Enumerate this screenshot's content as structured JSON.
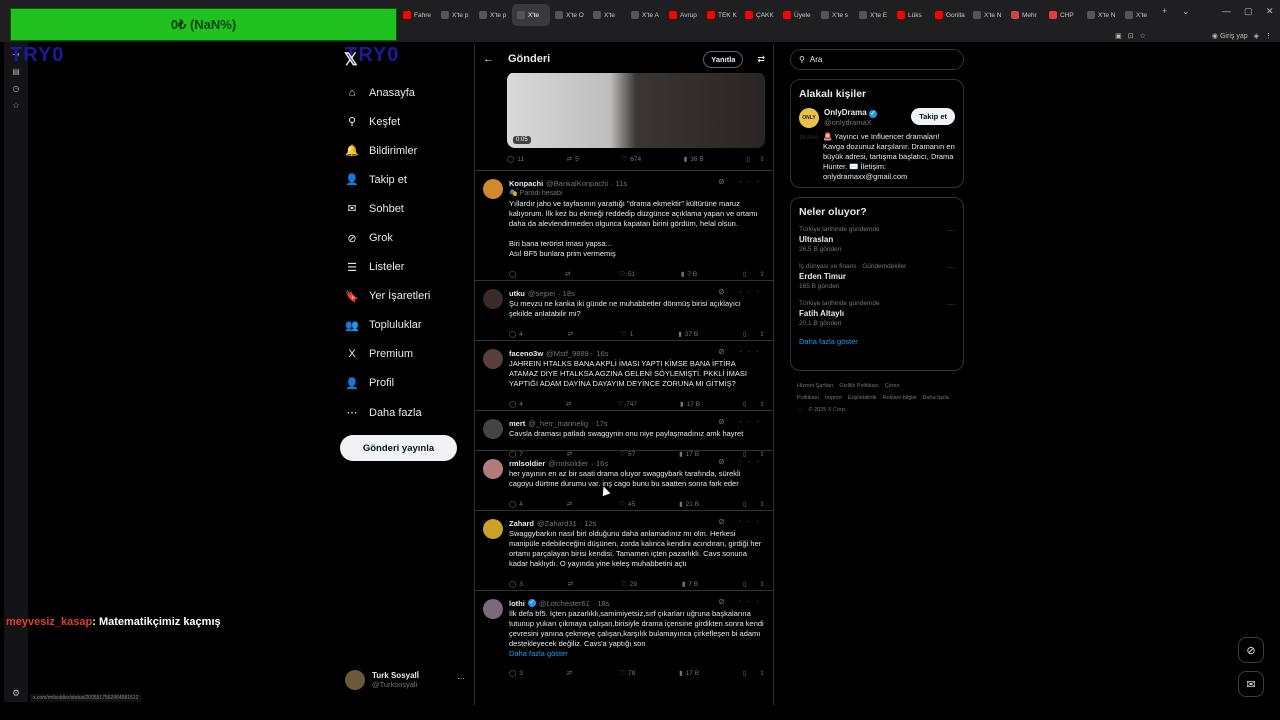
{
  "browser": {
    "tabs": [
      {
        "label": "Fahre",
        "color": "#ff0000"
      },
      {
        "label": "X'te p",
        "color": "#555"
      },
      {
        "label": "X'te p",
        "color": "#555"
      },
      {
        "label": "X'te",
        "color": "#555",
        "active": true
      },
      {
        "label": "X'te O",
        "color": "#555"
      },
      {
        "label": "X'te",
        "color": "#555"
      },
      {
        "label": "X'te A",
        "color": "#555"
      },
      {
        "label": "Avrup",
        "color": "#ff0000"
      },
      {
        "label": "TEK K",
        "color": "#ff0000"
      },
      {
        "label": "ÇAKK",
        "color": "#ff0000"
      },
      {
        "label": "Üyele",
        "color": "#ff0000"
      },
      {
        "label": "X'te s",
        "color": "#555"
      },
      {
        "label": "X'te E",
        "color": "#555"
      },
      {
        "label": "Lüks",
        "color": "#ff0000"
      },
      {
        "label": "Gorilla",
        "color": "#ff0000"
      },
      {
        "label": "X'te N",
        "color": "#555"
      },
      {
        "label": "Mehr",
        "color": "#c44"
      },
      {
        "label": "CHP",
        "color": "#e23b3b"
      },
      {
        "label": "X'te N",
        "color": "#555"
      },
      {
        "label": "X'te",
        "color": "#555"
      }
    ],
    "signin_label": "Giriş yap",
    "status_url": "x.com/rmlsoldier/status/2005517562964581512"
  },
  "overlay": {
    "counter": "0₺ (NaN%)",
    "watermark_left": "TRY0",
    "watermark_mid": "TRY0",
    "chat_user": "meyvesiz_kasap",
    "chat_msg": ": Matematikçimiz kaçmış"
  },
  "nav": {
    "items": [
      {
        "label": "Anasayfa",
        "icon": "⌂"
      },
      {
        "label": "Keşfet",
        "icon": "⚲"
      },
      {
        "label": "Bildirimler",
        "icon": "🔔"
      },
      {
        "label": "Takip et",
        "icon": "👤"
      },
      {
        "label": "Sohbet",
        "icon": "✉"
      },
      {
        "label": "Grok",
        "icon": "⊘"
      },
      {
        "label": "Listeler",
        "icon": "☰"
      },
      {
        "label": "Yer İşaretleri",
        "icon": "🔖"
      },
      {
        "label": "Topluluklar",
        "icon": "👥"
      },
      {
        "label": "Premium",
        "icon": "X"
      },
      {
        "label": "Profil",
        "icon": "👤"
      },
      {
        "label": "Daha fazla",
        "icon": "⋯"
      }
    ],
    "post_button": "Gönderi yayınla",
    "account_name": "Turk Sosyalİ",
    "account_handle": "@Turksosyali"
  },
  "main": {
    "title": "Gönderi",
    "reply_button": "Yanıtla",
    "media_duration": "0:05",
    "media_stats": {
      "replies": "11",
      "reposts": "5",
      "likes": "674",
      "views": "36 B"
    },
    "posts": [
      {
        "name": "Konpachi",
        "handle": "@BankalKonpachi",
        "time": "· 11s",
        "badge": "Parodi hesabı",
        "text": "Yıllardır jaho ve tayfasının yarattığı \"drama ekmektir\" kültürüne maruz kalıyorum. İlk kez bu ekmeği reddedip düzgünce açıklama yapan ve ortamı daha da alevlendirmeden olgunca kapatan birini gördüm, helal olsun.\n\nBiri bana terörist iması yapsa...\nAsıl BF5 bunlara prim vermemiş",
        "replies": "",
        "reposts": "",
        "likes": "51",
        "views": "7 B",
        "avatar": "#d08a2c"
      },
      {
        "name": "utku",
        "handle": "@sejpei",
        "time": "· 18s",
        "text": "Şu mevzu ne kanka iki günde ne muhabbetler dönmüş birisi açıklayıcı şekilde anlatabilir mi?",
        "replies": "4",
        "reposts": "",
        "likes": "1",
        "views": "37 B",
        "avatar": "#3a2a2a"
      },
      {
        "name": "faceno3w",
        "handle": "@Mstf_9889",
        "time": "· 16s",
        "text": "JAHREIN HTALKS BANA AKPLİ İMASI YAPTI KİMSE BANA İFTİRA ATAMAZ DİYE HTALKSA AGZINA GELENİ SÖYLEMİŞTİ. PKKLİ İMASI YAPTIĞI ADAM DAYİNA DAYAYIM DEYİNCE ZORUNA MI GİTMİŞ?",
        "replies": "4",
        "reposts": "",
        "likes": "747",
        "views": "17 B",
        "avatar": "#5a3d3d"
      },
      {
        "name": "mert",
        "handle": "@_herr_mannelig",
        "time": "· 17s",
        "text": "Cavsla draması patladı swaggynin onu niye paylaşmadınız amk hayret",
        "replies": "7",
        "reposts": "",
        "likes": "57",
        "views": "17 B",
        "avatar": "#444"
      },
      {
        "name": "rmlsoldier",
        "handle": "@rmlsoldier",
        "time": "· 16s",
        "text": "her yayının en az bir saati drama oluyor swaggybark tarafında, sürekli cagoyu dürtme durumu var. inş cago bunu bu saatten sonra fark eder",
        "replies": "4",
        "reposts": "",
        "likes": "45",
        "views": "21 B",
        "avatar": "#b47b7b"
      },
      {
        "name": "Zahard",
        "handle": "@Zahard31",
        "time": "· 12s",
        "text": "Swaggybarkın nasıl biri olduğunu daha anlamadınız mı olm. Herkesi manipüle edebileceğini düşünen, zorda kalınca kendini acındıran, girdiği her ortamı parçalayan birisi kendisi. Tamamen içten pazarlıklı.  Cavs sonuna kadar haklıydı. O yayında yine keleş muhabbetini açtı",
        "replies": "3",
        "reposts": "",
        "likes": "29",
        "views": "7 B",
        "avatar": "#c9a227"
      },
      {
        "name": "lothi",
        "handle": "@Lotchester61",
        "time": "· 18s",
        "verified": true,
        "text": "İlk defa bf5. İçten pazarlıklı,samimiyetsiz,sırf çıkarları uğruna başkalarına tutunup yukarı çıkmaya çalışan,birisiyle drama içerisine girdikten sonra kendi çevresini yanına çekmeye çalışan,karşılık bulamayınca çirkefleşen bi adamı destekleyecek değiliz. Cavs'a yaptığı son",
        "more": "Daha fazla göster",
        "replies": "3",
        "reposts": "",
        "likes": "78",
        "views": "17 B",
        "avatar": "#7a6a7a"
      }
    ]
  },
  "right": {
    "search_placeholder": "Ara",
    "who_title": "Alakalı kişiler",
    "who_name": "OnlyDrama",
    "who_handle": "@onlydramaX",
    "who_avatar_text": "ONLY DRAMA",
    "follow_label": "Takip et",
    "who_bio": "🚨 Yayıncı ve Influencer dramaları! Kavga dozunuz karşılanır. Dramanın en büyük adresi, tartışma başlatıcı, Drama Hunter. ✉️ İletişim: onlydramaxx@gmail.com",
    "trends_title": "Neler oluyor?",
    "trends": [
      {
        "cat": "Türkiye tarihinde gündemde",
        "topic": "Ultraslan",
        "count": "26,5 B gönderi"
      },
      {
        "cat": "İş dünyası ve finans · Gündemdekiler",
        "topic": "Erden Timur",
        "count": "165 B gönderi"
      },
      {
        "cat": "Türkiye tarihinde gündemde",
        "topic": "Fatih Altaylı",
        "count": "20,1 B gönderi"
      }
    ],
    "show_more": "Daha fazla göster",
    "footer": [
      "Hizmet Şartları",
      "Gizlilik Politikası",
      "Çerez Politikası",
      "İmprint",
      "Erişilebilirlik",
      "Reklam bilgisi",
      "Daha fazla ···",
      "© 2025 X Corp."
    ]
  }
}
